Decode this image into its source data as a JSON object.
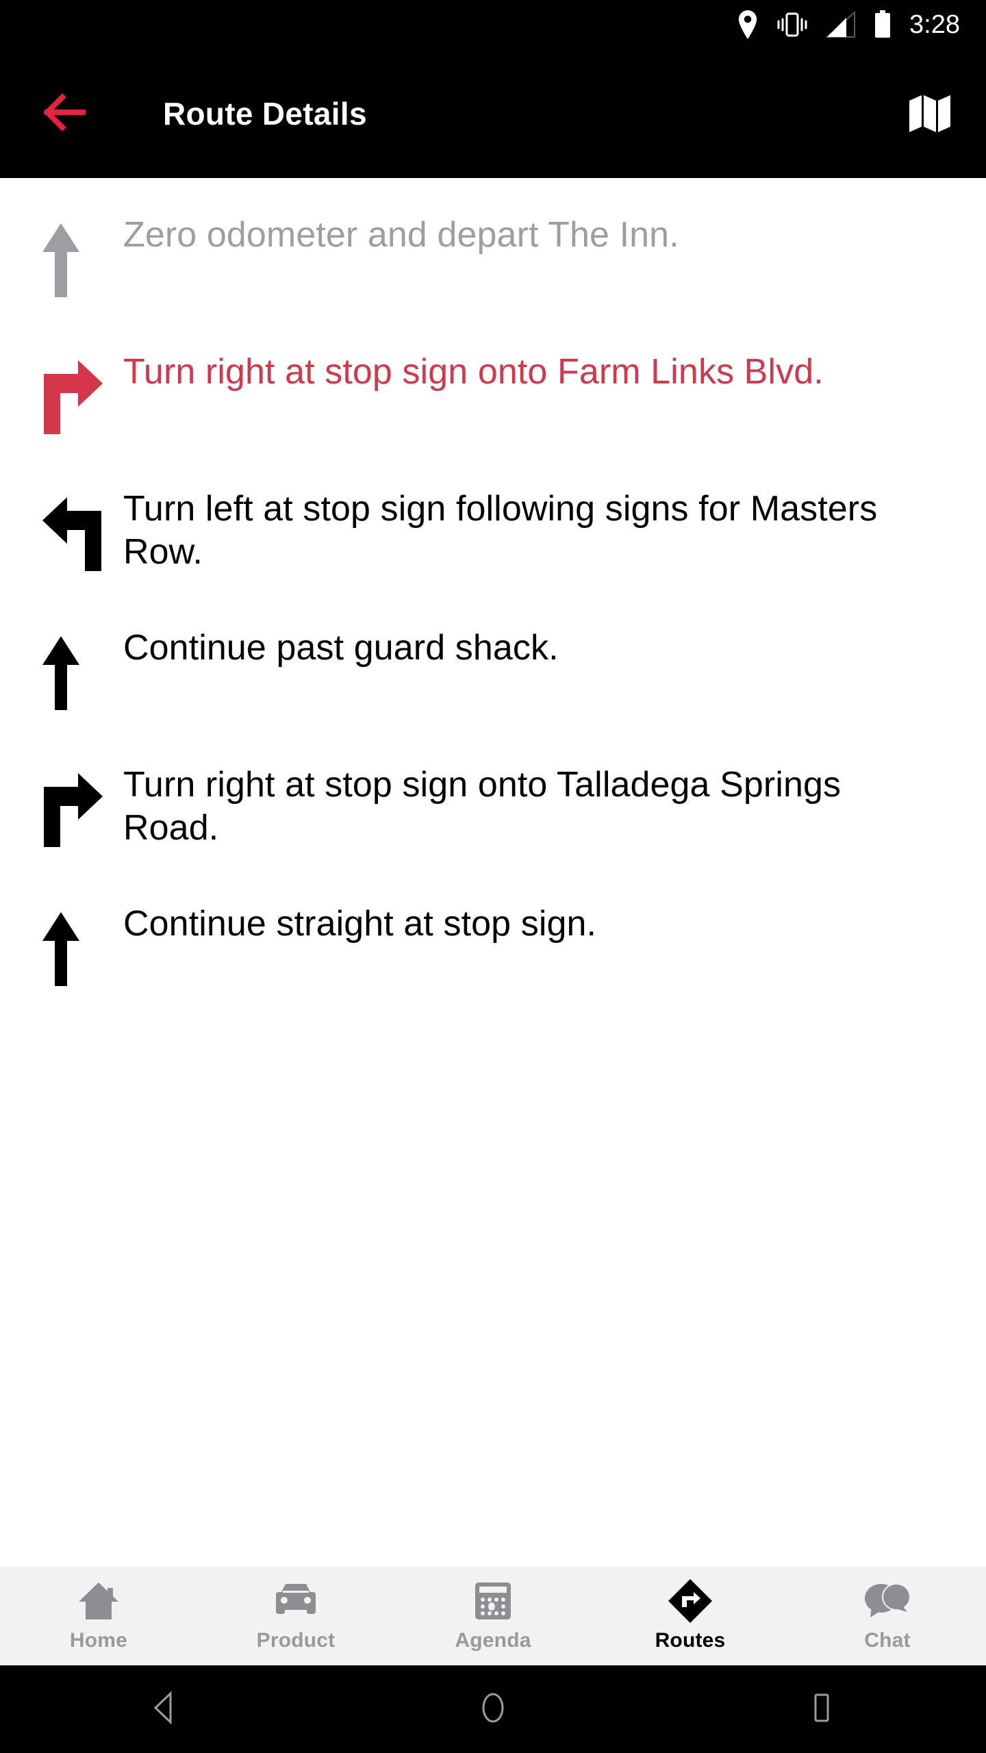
{
  "status_bar": {
    "time": "3:28",
    "icons": [
      "location-pin-icon",
      "vibrate-icon",
      "signal-bars-icon",
      "battery-icon"
    ],
    "background_color": "#000000",
    "foreground_color": "#ffffff"
  },
  "app_bar": {
    "title": "Route Details",
    "back_icon": "back-arrow-icon",
    "back_icon_color": "#e8213c",
    "action_icon": "map-icon",
    "action_icon_color": "#ffffff",
    "background_color": "#000000",
    "title_color": "#ffffff"
  },
  "colors": {
    "accent_red": "#d6364a",
    "completed_grey": "#9e9ea2",
    "active_text": "#000000",
    "nav_bar_bg": "#f2f1f4",
    "nav_inactive": "#9a999d"
  },
  "route_steps": [
    {
      "icon": "arrow-straight-icon",
      "text": "Zero odometer and depart The Inn.",
      "state": "done"
    },
    {
      "icon": "turn-right-icon",
      "text": "Turn right at stop sign onto Farm Links Blvd.",
      "state": "active"
    },
    {
      "icon": "turn-left-icon",
      "text": "Turn left at stop sign following signs for Masters Row.",
      "state": "normal"
    },
    {
      "icon": "arrow-straight-icon",
      "text": "Continue past guard shack.",
      "state": "normal"
    },
    {
      "icon": "turn-right-icon",
      "text": "Turn right at stop sign onto Talladega Springs Road.",
      "state": "normal"
    },
    {
      "icon": "arrow-straight-icon",
      "text": "Continue straight at stop sign.",
      "state": "normal"
    }
  ],
  "bottom_nav": {
    "tabs": [
      {
        "label": "Home",
        "icon": "house-icon",
        "active": false
      },
      {
        "label": "Product",
        "icon": "car-icon",
        "active": false
      },
      {
        "label": "Agenda",
        "icon": "calculator-icon",
        "active": false
      },
      {
        "label": "Routes",
        "icon": "route-diamond-icon",
        "active": true
      },
      {
        "label": "Chat",
        "icon": "chat-bubbles-icon",
        "active": false
      }
    ]
  },
  "system_nav": {
    "buttons": [
      {
        "name": "android-back-button",
        "icon": "triangle-back-icon"
      },
      {
        "name": "android-home-button",
        "icon": "circle-home-icon"
      },
      {
        "name": "android-recents-button",
        "icon": "square-recents-icon"
      }
    ],
    "background_color": "#000000",
    "icon_color": "#9d9d9d"
  }
}
